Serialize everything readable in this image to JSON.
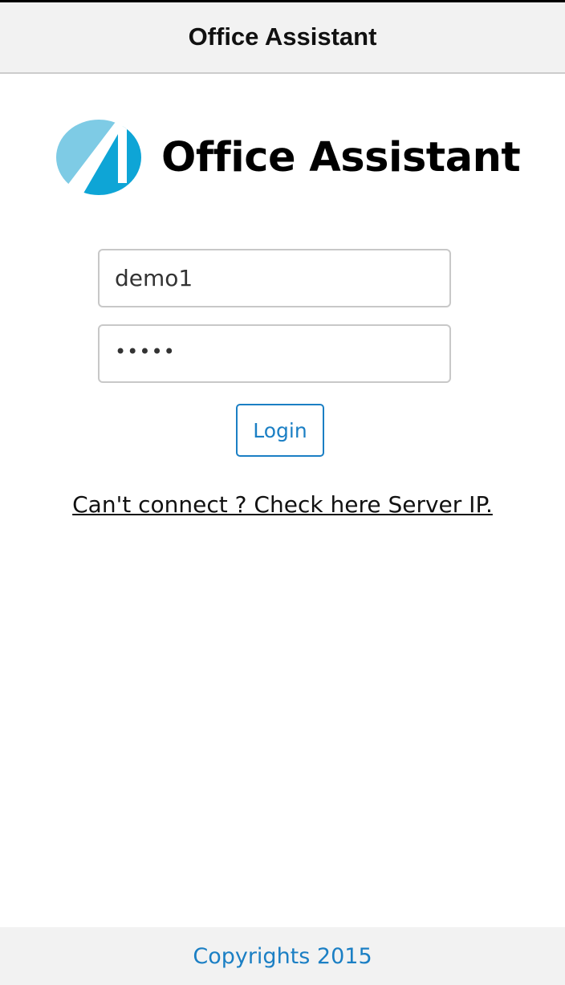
{
  "header": {
    "title": "Office Assistant"
  },
  "logo": {
    "text": "Office Assistant",
    "icon": "office-assistant-logo-icon",
    "colors": {
      "light_blue": "#7ecbe5",
      "dark_blue": "#0ea5d6"
    }
  },
  "login_form": {
    "username_value": "demo1",
    "password_value": "•••••",
    "login_label": "Login"
  },
  "links": {
    "server_ip": "Can't connect ? Check here Server IP."
  },
  "footer": {
    "text": "Copyrights 2015"
  },
  "colors": {
    "accent": "#1b7fc4",
    "header_bg": "#f2f2f2",
    "footer_bg": "#f2f2f2"
  }
}
